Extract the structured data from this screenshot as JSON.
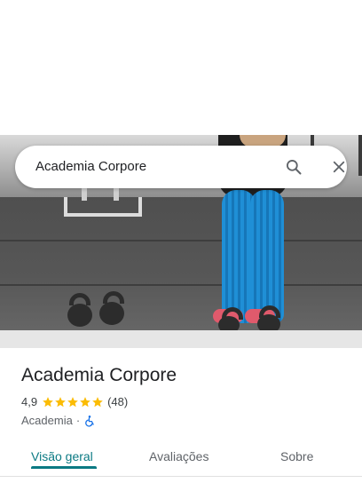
{
  "search": {
    "query": "Academia Corpore",
    "search_icon": "search-icon",
    "close_icon": "close-icon"
  },
  "place": {
    "name": "Academia Corpore",
    "rating": "4,9",
    "rating_value": 4.9,
    "stars_max": 5,
    "review_count": "(48)",
    "category": "Academia",
    "separator": "·",
    "accessibility_icon": "wheelchair-icon"
  },
  "tabs": [
    {
      "label": "Visão geral",
      "active": true
    },
    {
      "label": "Avaliações",
      "active": false
    },
    {
      "label": "Sobre",
      "active": false
    }
  ],
  "colors": {
    "accent": "#0b7a83",
    "star": "#fbbc04",
    "accessibility": "#1a73e8"
  }
}
